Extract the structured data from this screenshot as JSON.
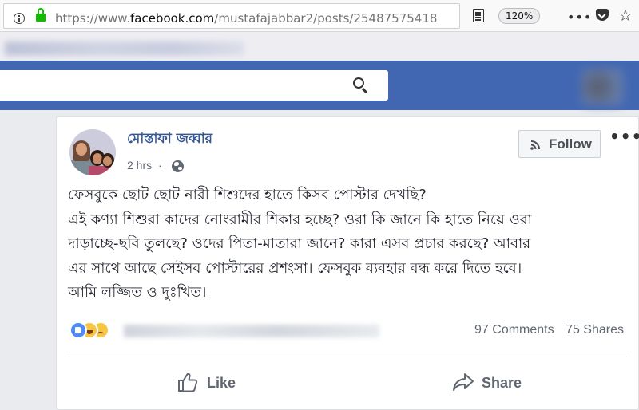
{
  "browser": {
    "url_prefix": "https://www.",
    "url_domain": "facebook.com",
    "url_path": "/mustafajabbar2/posts/25487575418",
    "zoom": "120%"
  },
  "post": {
    "author": "মোস্তাফা জব্বার",
    "time": "2 hrs",
    "follow_label": "Follow",
    "body_lines": [
      "ফেসবুকে ছোট ছোট নারী শিশুদের হাতে কিসব পোস্টার দেখছি?",
      "এই কণ্যা শিশুরা কাদের নোংরামীর শিকার হচ্ছে? ওরা কি জানে কি হাতে নিয়ে ওরা",
      "দাড়াচ্ছে-ছবি তুলছে? ওদের পিতা-মাতারা জানে? কারা এসব প্রচার করছে? আবার",
      "এর সাথে আছে সেইসব পোস্টারের প্রশংসা। ফেসবুক ব্যবহার বন্ধ করে দিতে হবে।",
      "আমি লজ্জিত ও দুঃখিত।"
    ],
    "comments": "97 Comments",
    "shares": "75 Shares",
    "like_label": "Like",
    "share_label": "Share"
  },
  "colors": {
    "facebook_blue": "#4267b2",
    "author_link": "#365899",
    "lock_green": "#12bc00"
  },
  "icons": [
    "info-icon",
    "lock-icon",
    "reader-icon",
    "more-dots-icon",
    "pocket-icon",
    "star-icon",
    "search-icon",
    "globe-icon",
    "rss-icon",
    "like-icon",
    "share-icon"
  ]
}
